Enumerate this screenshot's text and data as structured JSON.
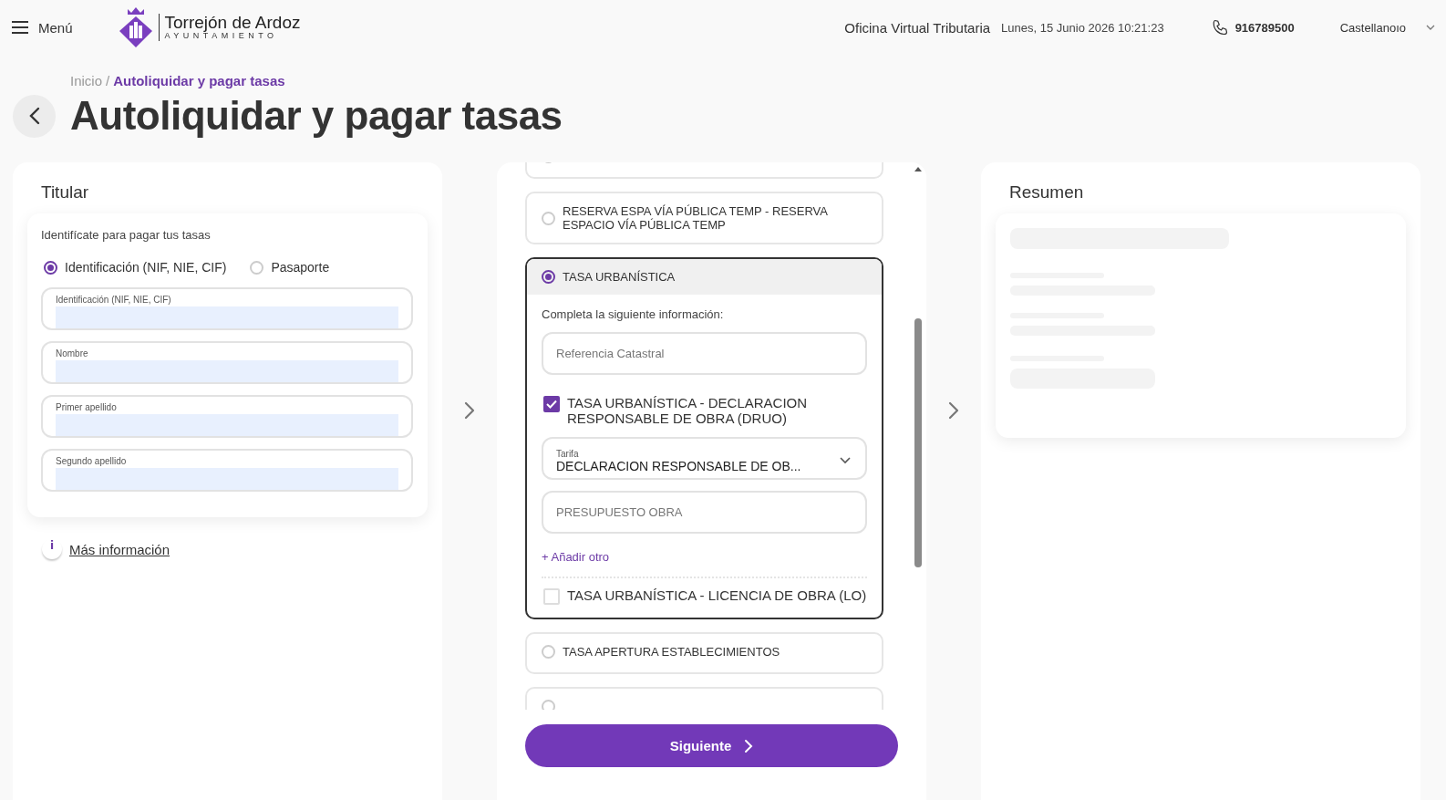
{
  "header": {
    "menu_label": "Menú",
    "logo": {
      "name": "Torrejón de Ardoz",
      "subtitle": "AYUNTAMIENTO"
    },
    "office": "Oficina Virtual Tributaria",
    "datetime": "Lunes, 15 Junio 2026 10:21:23",
    "phone": "916789500",
    "language": "Castellanoıo"
  },
  "breadcrumb": {
    "separator": "/",
    "items": [
      {
        "label": "Inicio",
        "selected": false
      },
      {
        "label": "Autoliquidar y pagar tasas",
        "selected": true
      }
    ]
  },
  "title": "Autoliquidar y pagar tasas",
  "titular": {
    "title": "Titular",
    "prompt": "Identifícate para pagar tus tasas",
    "id_types": [
      {
        "label": "Identificación (NIF, NIE, CIF)",
        "selected": true
      },
      {
        "label": "Pasaporte",
        "selected": false
      }
    ],
    "fields": [
      {
        "label": "Identificación (NIF, NIE, CIF)"
      },
      {
        "label": "Nombre"
      },
      {
        "label": "Primer apellido"
      },
      {
        "label": "Segundo apellido"
      }
    ],
    "more_info_icon": "i",
    "more_info": "Más información"
  },
  "tasas": {
    "items": [
      {
        "selected": false
      },
      {
        "label": "RESERVA ESPA VÍA PÚBLICA TEMP - RESERVA ESPACIO VÍA PÚBLICA TEMP",
        "selected": false
      },
      {
        "label": "TASA URBANÍSTICA",
        "selected": true,
        "details": {
          "instruction": "Completa la siguiente información:",
          "reference_placeholder": "Referencia Catastral",
          "options": [
            {
              "label": "TASA URBANÍSTICA - DECLARACION RESPONSABLE DE OBRA (DRUO)",
              "checked": true,
              "tarifa": {
                "label": "Tarifa",
                "value": "DECLARACION RESPONSABLE DE OB..."
              },
              "budget_placeholder": "PRESUPUESTO OBRA",
              "add_label": "+ Añadir otro"
            },
            {
              "label": "TASA URBANÍSTICA - LICENCIA DE OBRA (LO)",
              "checked": false
            }
          ]
        }
      },
      {
        "label": "TASA APERTURA ESTABLECIMIENTOS",
        "selected": false
      },
      {
        "selected": false
      }
    ],
    "next_button": "Siguiente"
  },
  "resumen": {
    "title": "Resumen"
  }
}
